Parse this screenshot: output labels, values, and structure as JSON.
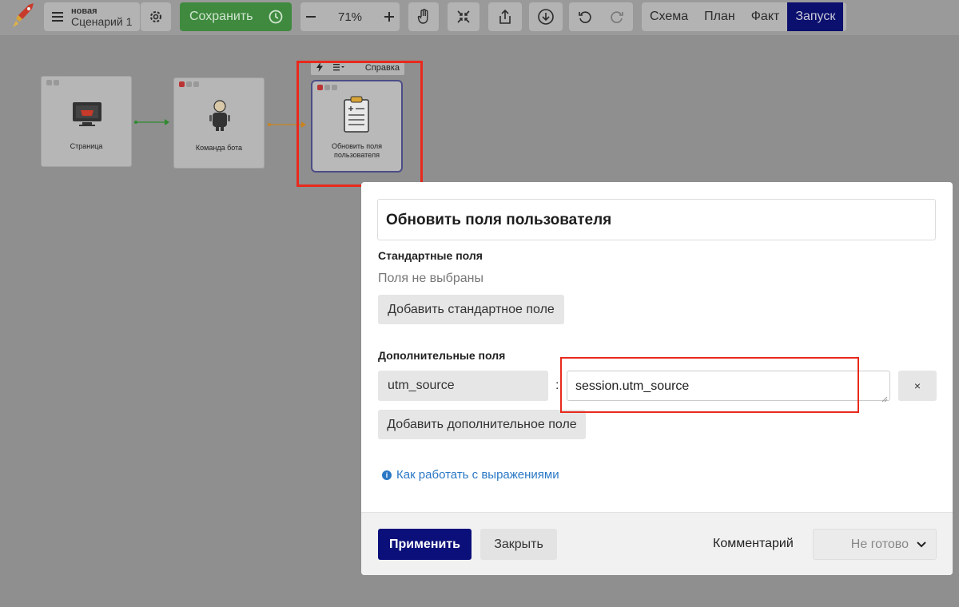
{
  "toolbar": {
    "doc_status": "новая",
    "doc_name": "Сценарий 1",
    "save_label": "Сохранить",
    "zoom_level": "71%",
    "view_tabs": [
      "Схема",
      "План",
      "Факт",
      "Запуск"
    ],
    "active_view": "Запуск",
    "icons": [
      "rocket-logo",
      "menu-icon",
      "gear-icon",
      "history-icon",
      "minus-icon",
      "plus-icon",
      "hand-icon",
      "fit-icon",
      "share-icon",
      "download-icon",
      "undo-icon",
      "redo-icon"
    ]
  },
  "canvas": {
    "nodes": [
      {
        "label": "Страница",
        "icon": "monitor-basket-icon"
      },
      {
        "label": "Команда бота",
        "icon": "robot-icon"
      },
      {
        "label_line1": "Обновить поля",
        "label_line2": "пользователя",
        "icon": "clipboard-icon"
      }
    ],
    "node_toolbar_help": "Справка",
    "connector_colors": [
      "#2f8a2f",
      "#c9831e"
    ]
  },
  "dialog": {
    "title": "Обновить поля пользователя",
    "standard_fields_label": "Стандартные поля",
    "no_fields_text": "Поля не выбраны",
    "add_standard_label": "Добавить стандартное поле",
    "extra_fields_label": "Дополнительные поля",
    "extra_field": {
      "key": "utm_source",
      "separator": ":",
      "value": "session.utm_source",
      "remove_label": "×"
    },
    "add_extra_label": "Добавить дополнительное поле",
    "help_link": "Как работать с выражениями",
    "footer": {
      "apply_label": "Применить",
      "close_label": "Закрыть",
      "comment_label": "Комментарий",
      "status_value": "Не готово"
    }
  },
  "colors": {
    "accent": "#0b0f7a",
    "save": "#3f8a3f",
    "link": "#2a78c5",
    "highlight": "#e8291c"
  }
}
